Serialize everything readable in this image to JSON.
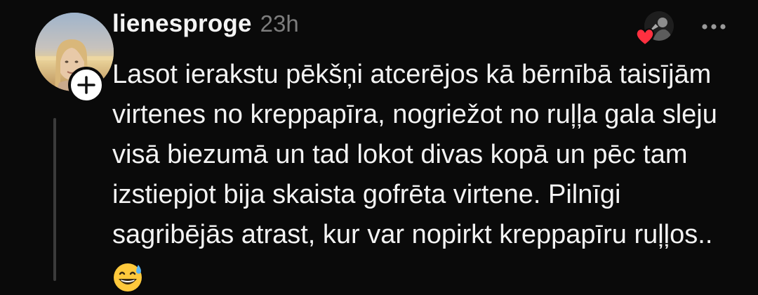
{
  "comment": {
    "username": "lienesproge",
    "timestamp": "23h",
    "lines": [
      "Lasot ierakstu pēkšņi atcerējos kā bērnībā taisījām",
      "virtenes no kreppapīra, nogriežot no ruļļa gala sleju",
      "visā biezumā un tad lokot divas kopā un pēc tam",
      "izstiepjot bija skaista gofrēta virtene. Pilnīgi",
      "sagribējās atrast, kur var nopirkt kreppapīru ruļļos.."
    ],
    "emoji": "grinning-face-with-sweat"
  },
  "icons": {
    "follow": "plus-icon",
    "like_badge": "heart-icon",
    "more": "more-horizontal-icon"
  },
  "colors": {
    "background": "#0a0a0a",
    "text": "#f3f3f3",
    "muted": "#7d7d7d",
    "thread_line": "#3b3b3b",
    "heart": "#ff3040"
  }
}
